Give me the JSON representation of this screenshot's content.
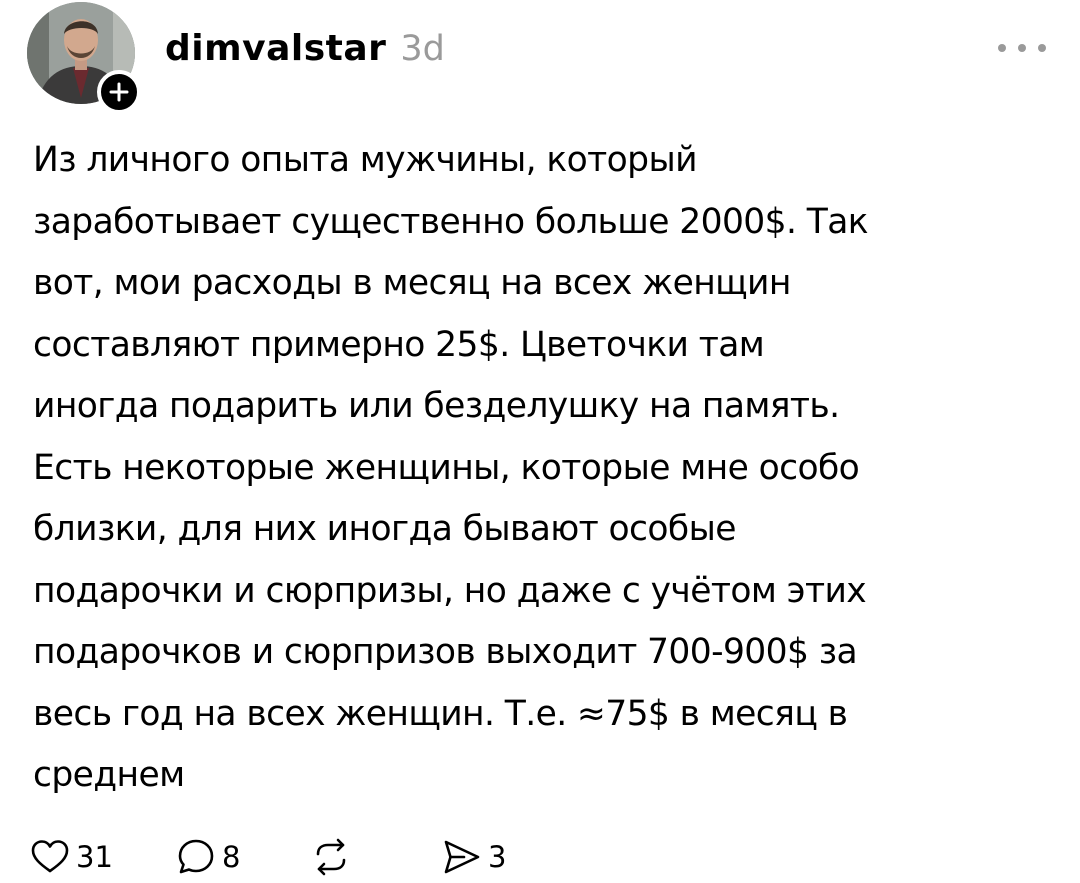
{
  "post": {
    "username": "dimvalstar",
    "timestamp": "3d",
    "text_lines": [
      "Из личного опыта мужчины, который",
      "заработывает существенно больше 2000$. Так",
      "вот, мои расходы в месяц на всех женщин",
      "составляют примерно 25$. Цветочки там",
      "иногда подарить или безделушку на память.",
      "Есть некоторые женщины, которые мне особо",
      "близки, для них иногда бывают особые",
      "подарочки и сюрпризы, но даже с учётом этих",
      "подарочков и сюрпризов выходит 700-900$ за",
      "весь год на всех женщин. Т.е. ≈75$ в месяц в",
      "среднем"
    ],
    "actions": {
      "like_count": "31",
      "reply_count": "8",
      "repost_count": "",
      "share_count": "3"
    }
  },
  "icons": {
    "like": "heart-icon",
    "reply": "speech-bubble-icon",
    "repost": "repost-arrows-icon",
    "share": "send-arrow-icon",
    "follow": "plus-icon",
    "more": "ellipsis-icon"
  },
  "colors": {
    "text": "#000000",
    "muted": "#9a9a9a",
    "background": "#ffffff"
  }
}
